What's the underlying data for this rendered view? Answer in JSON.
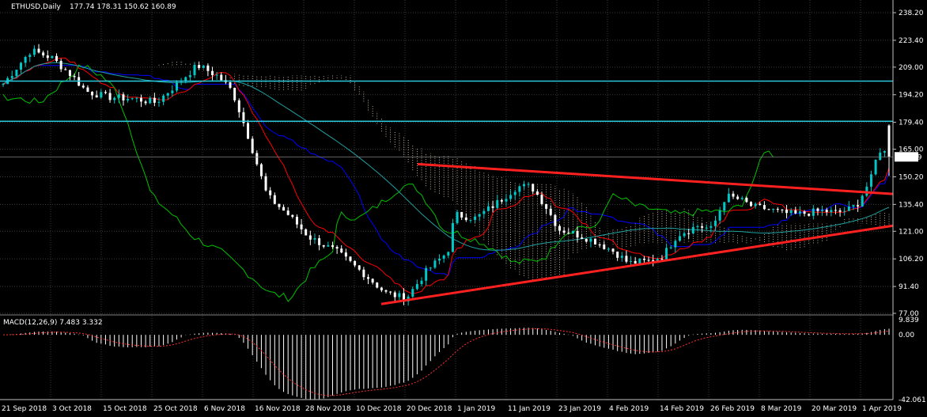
{
  "header": {
    "symbol": "ETHUSD,Daily",
    "ohlc": "177.74 178.31 150.62 160.89"
  },
  "macd_panel": {
    "label": "MACD(12,26,9) 7.483 3.332",
    "ticks": [
      "9.839",
      "0.00",
      "-42.061"
    ]
  },
  "current_price": "160.89",
  "colors": {
    "background": "#000000",
    "grid": "#3a3a3a",
    "bull": "#00c8c8",
    "bear": "#ffffff",
    "hline": "#28c8dc",
    "trend": "#ff2020",
    "kijun": "#0000ff",
    "tenkan": "#ff0000",
    "chikou": "#00c000",
    "kumo": "#f0d8b8",
    "ma": "#20a0a0",
    "macd": "#ffffff",
    "signal": "#ff3030"
  },
  "chart_data": {
    "type": "candlestick",
    "price_ticks": [
      "238.20",
      "223.40",
      "209.00",
      "194.20",
      "179.40",
      "165.00",
      "150.20",
      "135.40",
      "121.00",
      "106.20",
      "91.40",
      "77.00"
    ],
    "ylim": [
      77.0,
      245.0
    ],
    "x_ticks": [
      "21 Sep 2018",
      "3 Oct 2018",
      "15 Oct 2018",
      "25 Oct 2018",
      "6 Nov 2018",
      "16 Nov 2018",
      "28 Nov 2018",
      "10 Dec 2018",
      "20 Dec 2018",
      "1 Jan 2019",
      "11 Jan 2019",
      "23 Jan 2019",
      "4 Feb 2019",
      "14 Feb 2019",
      "26 Feb 2019",
      "8 Mar 2019",
      "20 Mar 2019",
      "1 Apr 2019"
    ],
    "horizontal_levels": [
      201.5,
      180.0
    ],
    "trendlines": [
      {
        "name": "upper",
        "from": [
          "20 Dec 2018",
          157.0
        ],
        "to": [
          "after 1 Apr 2019",
          141.0
        ]
      },
      {
        "name": "lower",
        "from": [
          "14 Dec 2018",
          82.0
        ],
        "to": [
          "after 1 Apr 2019",
          124.0
        ]
      }
    ],
    "last_candle": {
      "open": 177.74,
      "high": 178.31,
      "low": 150.62,
      "close": 160.89
    },
    "macd": {
      "value": 7.483,
      "signal": 3.332,
      "ylim": [
        -42.061,
        9.839
      ]
    }
  }
}
